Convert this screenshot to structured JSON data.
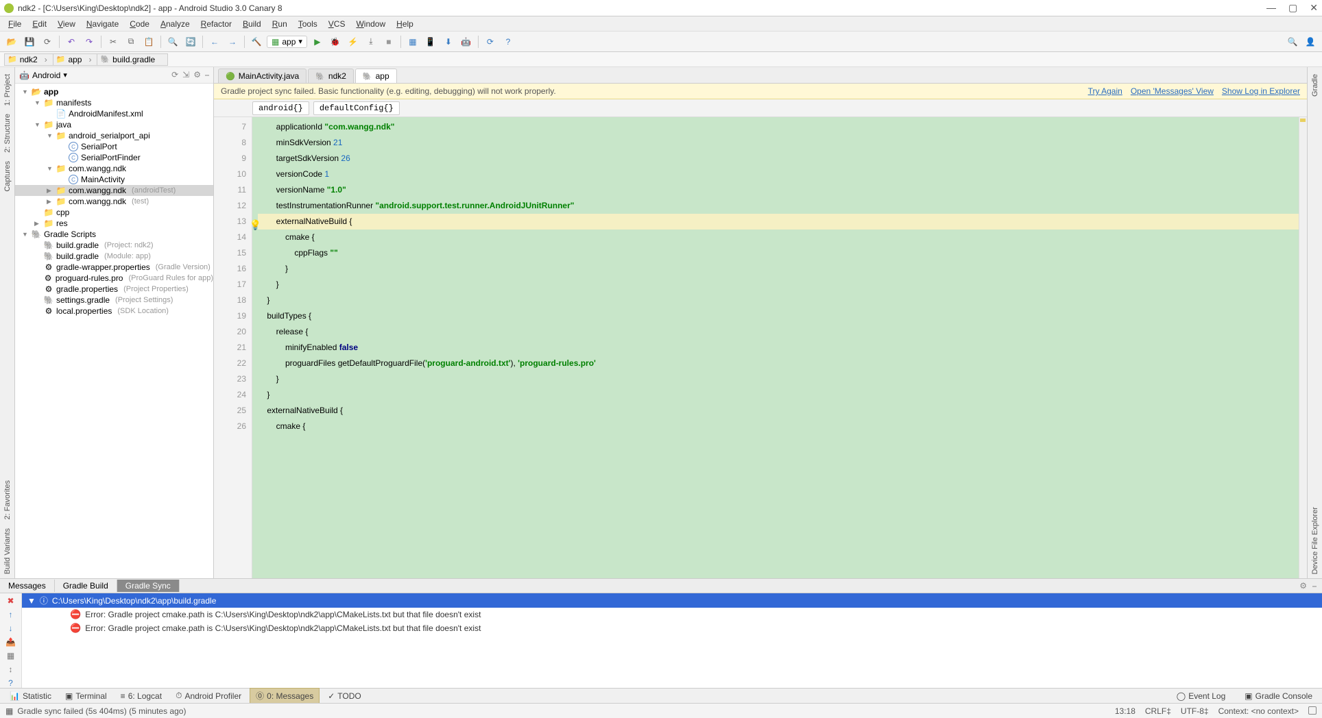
{
  "titlebar": {
    "text": "ndk2 - [C:\\Users\\King\\Desktop\\ndk2] - app - Android Studio 3.0 Canary 8"
  },
  "menu": [
    "File",
    "Edit",
    "View",
    "Navigate",
    "Code",
    "Analyze",
    "Refactor",
    "Build",
    "Run",
    "Tools",
    "VCS",
    "Window",
    "Help"
  ],
  "breadcrumb": [
    {
      "icon": "folder",
      "label": "ndk2"
    },
    {
      "icon": "folder",
      "label": "app"
    },
    {
      "icon": "gradle",
      "label": "build.gradle"
    }
  ],
  "run_config": "app",
  "left_strip": [
    "1: Project",
    "2: Structure",
    "Captures"
  ],
  "left_strip_bottom": [
    "2: Favorites",
    "Build Variants"
  ],
  "right_strip": [
    "Gradle"
  ],
  "right_strip_bottom": [
    "Device File Explorer"
  ],
  "project_panel": {
    "dropdown": "Android",
    "tree": [
      {
        "d": 0,
        "chev": "▼",
        "icon": "folder-open",
        "label": "app",
        "bold": true
      },
      {
        "d": 1,
        "chev": "▼",
        "icon": "folder",
        "label": "manifests"
      },
      {
        "d": 2,
        "chev": "",
        "icon": "xml",
        "label": "AndroidManifest.xml"
      },
      {
        "d": 1,
        "chev": "▼",
        "icon": "folder",
        "label": "java"
      },
      {
        "d": 2,
        "chev": "▼",
        "icon": "folder",
        "label": "android_serialport_api"
      },
      {
        "d": 3,
        "chev": "",
        "icon": "class",
        "label": "SerialPort"
      },
      {
        "d": 3,
        "chev": "",
        "icon": "class",
        "label": "SerialPortFinder"
      },
      {
        "d": 2,
        "chev": "▼",
        "icon": "folder",
        "label": "com.wangg.ndk"
      },
      {
        "d": 3,
        "chev": "",
        "icon": "class",
        "label": "MainActivity"
      },
      {
        "d": 2,
        "chev": "▶",
        "icon": "folder",
        "label": "com.wangg.ndk",
        "hint": "(androidTest)",
        "sel": true
      },
      {
        "d": 2,
        "chev": "▶",
        "icon": "folder",
        "label": "com.wangg.ndk",
        "hint": "(test)"
      },
      {
        "d": 1,
        "chev": "",
        "icon": "folder",
        "label": "cpp"
      },
      {
        "d": 1,
        "chev": "▶",
        "icon": "folder",
        "label": "res"
      },
      {
        "d": 0,
        "chev": "▼",
        "icon": "gradle",
        "label": "Gradle Scripts"
      },
      {
        "d": 1,
        "chev": "",
        "icon": "gradle",
        "label": "build.gradle",
        "hint": "(Project: ndk2)"
      },
      {
        "d": 1,
        "chev": "",
        "icon": "gradle",
        "label": "build.gradle",
        "hint": "(Module: app)"
      },
      {
        "d": 1,
        "chev": "",
        "icon": "prop",
        "label": "gradle-wrapper.properties",
        "hint": "(Gradle Version)"
      },
      {
        "d": 1,
        "chev": "",
        "icon": "prop",
        "label": "proguard-rules.pro",
        "hint": "(ProGuard Rules for app)"
      },
      {
        "d": 1,
        "chev": "",
        "icon": "prop",
        "label": "gradle.properties",
        "hint": "(Project Properties)"
      },
      {
        "d": 1,
        "chev": "",
        "icon": "gradle",
        "label": "settings.gradle",
        "hint": "(Project Settings)"
      },
      {
        "d": 1,
        "chev": "",
        "icon": "prop",
        "label": "local.properties",
        "hint": "(SDK Location)"
      }
    ]
  },
  "editor": {
    "tabs": [
      {
        "icon": "class",
        "label": "MainActivity.java",
        "active": false
      },
      {
        "icon": "gradle",
        "label": "ndk2",
        "active": false
      },
      {
        "icon": "gradle",
        "label": "app",
        "active": true
      }
    ],
    "notice": "Gradle project sync failed. Basic functionality (e.g. editing, debugging) will not work properly.",
    "notice_links": [
      "Try Again",
      "Open 'Messages' View",
      "Show Log in Explorer"
    ],
    "crumbs": [
      "android{}",
      "defaultConfig{}"
    ],
    "first_line": 7,
    "lines": [
      {
        "t": "        applicationId ",
        "s": "\"com.wangg.ndk\""
      },
      {
        "t": "        minSdkVersion ",
        "n": "21"
      },
      {
        "t": "        targetSdkVersion ",
        "n": "26"
      },
      {
        "t": "        versionCode ",
        "n": "1"
      },
      {
        "t": "        versionName ",
        "s": "\"1.0\""
      },
      {
        "t": "        testInstrumentationRunner ",
        "s": "\"android.support.test.runner.AndroidJUnitRunner\""
      },
      {
        "t": "        externalNativeBuild {",
        "hl": true
      },
      {
        "t": "            cmake {"
      },
      {
        "t": "                cppFlags ",
        "s": "\"\""
      },
      {
        "t": "            }"
      },
      {
        "t": "        }"
      },
      {
        "t": "    }"
      },
      {
        "t": "    buildTypes {"
      },
      {
        "t": "        release {"
      },
      {
        "t": "            minifyEnabled ",
        "k": "false"
      },
      {
        "t": "            proguardFiles getDefaultProguardFile(",
        "s": "'proguard-android.txt'",
        "t2": "), ",
        "s2": "'proguard-rules.pro'"
      },
      {
        "t": "        }"
      },
      {
        "t": "    }"
      },
      {
        "t": "    externalNativeBuild {"
      },
      {
        "t": "        cmake {"
      }
    ]
  },
  "messages": {
    "tabs": [
      "Messages",
      "Gradle Build",
      "Gradle Sync"
    ],
    "active_tab": 2,
    "header": "C:\\Users\\King\\Desktop\\ndk2\\app\\build.gradle",
    "errors": [
      "Error:  Gradle project cmake.path is C:\\Users\\King\\Desktop\\ndk2\\app\\CMakeLists.txt but that file doesn't exist",
      "Error:  Gradle project cmake.path is C:\\Users\\King\\Desktop\\ndk2\\app\\CMakeLists.txt but that file doesn't exist"
    ]
  },
  "bottom_tabs": [
    {
      "icon": "📊",
      "label": "Statistic"
    },
    {
      "icon": "▣",
      "label": "Terminal"
    },
    {
      "icon": "≡",
      "label": "6: Logcat"
    },
    {
      "icon": "⏱",
      "label": "Android Profiler"
    },
    {
      "icon": "⓪",
      "label": "0: Messages",
      "active": true
    },
    {
      "icon": "✓",
      "label": "TODO"
    }
  ],
  "bottom_right": [
    {
      "icon": "◯",
      "label": "Event Log"
    },
    {
      "icon": "▣",
      "label": "Gradle Console"
    }
  ],
  "status": {
    "left": "Gradle sync failed (5s 404ms) (5 minutes ago)",
    "right": [
      "13:18",
      "CRLF‡",
      "UTF-8‡",
      "Context: <no context>"
    ]
  }
}
